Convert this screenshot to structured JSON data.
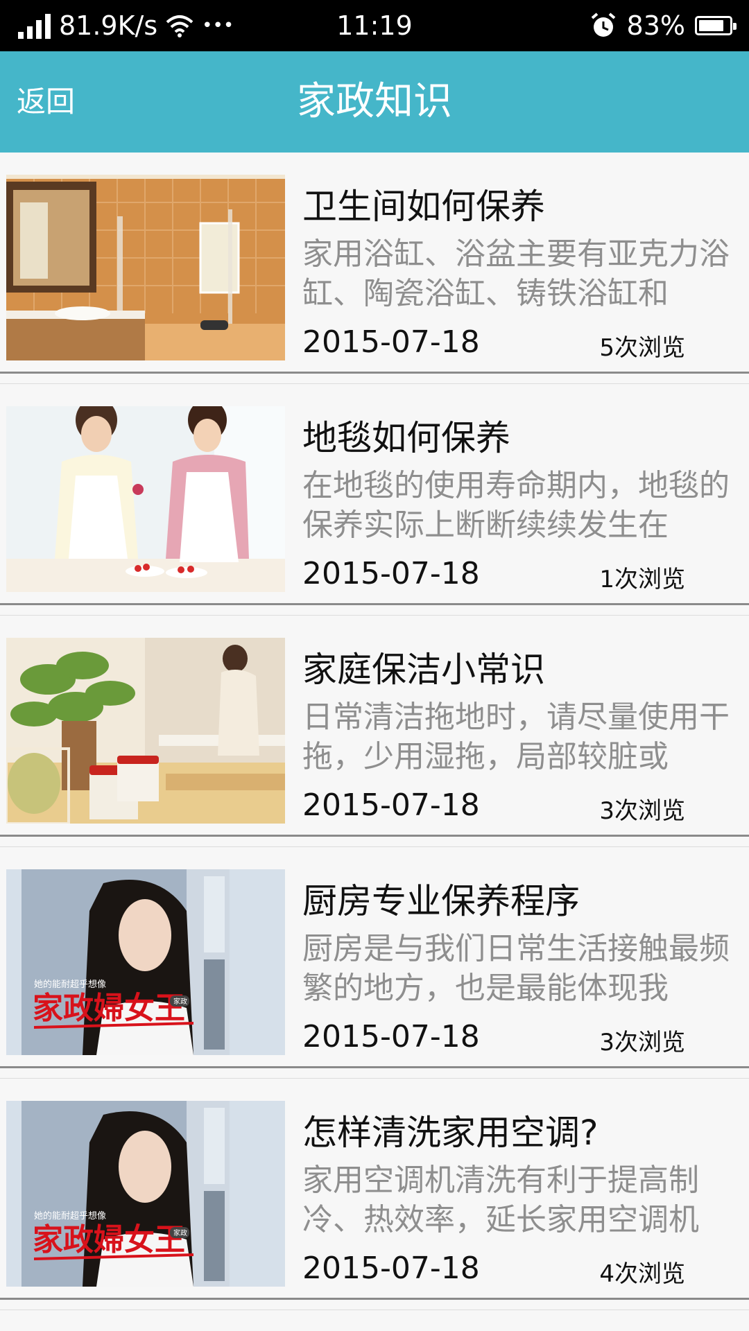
{
  "status_bar": {
    "speed": "81.9K/s",
    "more": "•••",
    "time": "11:19",
    "battery": "83%",
    "battery_level": 0.83
  },
  "header": {
    "back_label": "返回",
    "title": "家政知识",
    "color": "#45b6c9"
  },
  "articles": [
    {
      "title": "卫生间如何保养",
      "excerpt": "家用浴缸、浴盆主要有亚克力浴缸、陶瓷浴缸、铸铁浴缸和",
      "date": "2015-07-18",
      "views": "5次浏览",
      "image": "bathroom-photo"
    },
    {
      "title": "地毯如何保养",
      "excerpt": "在地毯的使用寿命期内，地毯的保养实际上断断续续发生在",
      "date": "2015-07-18",
      "views": "1次浏览",
      "image": "women-kitchen-photo"
    },
    {
      "title": "家庭保洁小常识",
      "excerpt": "日常清洁拖地时，请尽量使用干拖，少用湿拖，局部较脏或",
      "date": "2015-07-18",
      "views": "3次浏览",
      "image": "kitchen-plant-photo"
    },
    {
      "title": "厨房专业保养程序",
      "excerpt": "厨房是与我们日常生活接触最频繁的地方，也是最能体现我",
      "date": "2015-07-18",
      "views": "3次浏览",
      "image": "drama-poster",
      "poster_small": "她的能耐超乎想像",
      "poster_big": "家政婦女王",
      "poster_badge": "家政"
    },
    {
      "title": "怎样清洗家用空调?",
      "excerpt": "家用空调机清洗有利于提高制冷、热效率，延长家用空调机",
      "date": "2015-07-18",
      "views": "4次浏览",
      "image": "drama-poster",
      "poster_small": "她的能耐超乎想像",
      "poster_big": "家政婦女王",
      "poster_badge": "家政"
    }
  ]
}
